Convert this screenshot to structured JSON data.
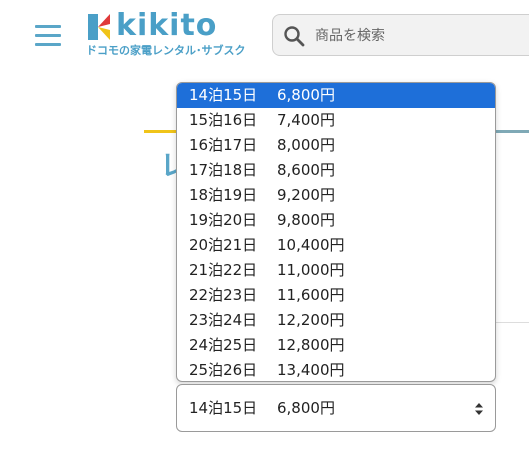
{
  "header": {
    "logo_text": "kikito",
    "tagline": "ドコモの家電レンタル･サブスク",
    "brand_colors": {
      "primary": "#4a9fc7",
      "mark_red": "#e03a3a",
      "mark_yellow": "#f0c419",
      "mark_blue": "#4a9fc7"
    }
  },
  "search": {
    "placeholder": "商品を検索",
    "icon": "search-icon"
  },
  "background": {
    "heading_char": "レ"
  },
  "rental_select": {
    "selected_days": "14泊15日",
    "selected_price": "6,800円",
    "highlight_color": "#1e6fd9",
    "options": [
      {
        "days": "14泊15日",
        "price": "6,800円"
      },
      {
        "days": "15泊16日",
        "price": "7,400円"
      },
      {
        "days": "16泊17日",
        "price": "8,000円"
      },
      {
        "days": "17泊18日",
        "price": "8,600円"
      },
      {
        "days": "18泊19日",
        "price": "9,200円"
      },
      {
        "days": "19泊20日",
        "price": "9,800円"
      },
      {
        "days": "20泊21日",
        "price": "10,400円"
      },
      {
        "days": "21泊22日",
        "price": "11,000円"
      },
      {
        "days": "22泊23日",
        "price": "11,600円"
      },
      {
        "days": "23泊24日",
        "price": "12,200円"
      },
      {
        "days": "24泊25日",
        "price": "12,800円"
      },
      {
        "days": "25泊26日",
        "price": "13,400円"
      }
    ]
  }
}
